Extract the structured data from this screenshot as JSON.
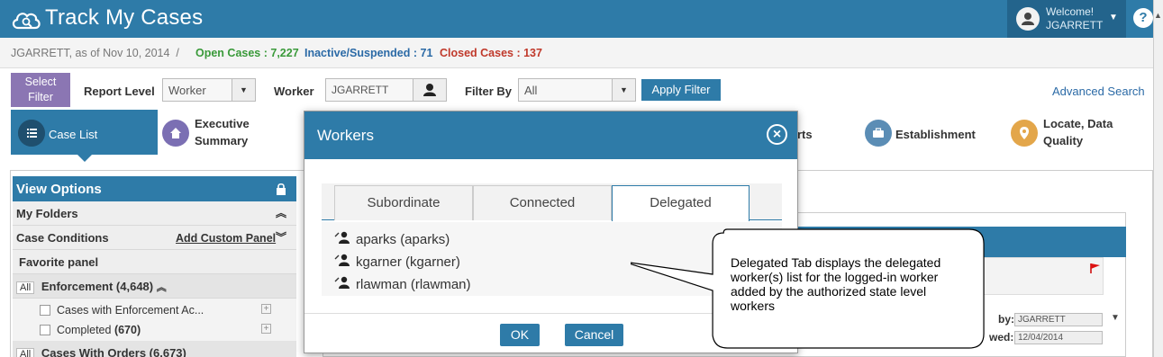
{
  "header": {
    "title": "Track My Cases",
    "welcome_label": "Welcome!",
    "welcome_user": "JGARRETT",
    "help_label": "?"
  },
  "status": {
    "user_date": "JGARRETT, as of Nov 10, 2014",
    "separator": "/",
    "open_cases": "Open Cases : 7,227",
    "inactive": "Inactive/Suspended : 71",
    "closed_cases": "Closed Cases : 137"
  },
  "filter": {
    "select_filter_line1": "Select",
    "select_filter_line2": "Filter",
    "report_level_label": "Report Level",
    "report_level_value": "Worker",
    "worker_label": "Worker",
    "worker_value": "JGARRETT",
    "filter_by_label": "Filter By",
    "filter_by_value": "All",
    "apply_label": "Apply Filter",
    "advanced_search": "Advanced Search"
  },
  "tabs": [
    {
      "label": "Case List",
      "icon": "list-icon"
    },
    {
      "label_line1": "Executive",
      "label_line2": "Summary",
      "icon": "home-icon"
    },
    {
      "label": "rts"
    },
    {
      "label": "Establishment",
      "icon": "briefcase-icon"
    },
    {
      "label_line1": "Locate, Data",
      "label_line2": "Quality",
      "icon": "location-pin-icon"
    }
  ],
  "sidebar": {
    "title": "View Options",
    "my_folders": "My Folders",
    "case_conditions": "Case Conditions",
    "add_custom_panel": "Add Custom Panel",
    "favorite_panel": "Favorite panel",
    "all_chip": "All",
    "enforcement": "Enforcement (4,648)",
    "item1_label": "Cases with Enforcement Ac...",
    "item2_label": "Completed",
    "item2_count": "(670)",
    "cases_with_orders": "Cases With Orders (6,673)"
  },
  "background_panel": {
    "by_label": "by:",
    "by_value": "JGARRETT",
    "wed_label": "wed:",
    "wed_value": "12/04/2014"
  },
  "modal": {
    "title": "Workers",
    "tabs": [
      "Subordinate",
      "Connected",
      "Delegated"
    ],
    "active_tab": "Delegated",
    "workers": [
      "aparks (aparks)",
      "kgarner (kgarner)",
      "rlawman (rlawman)"
    ],
    "ok_label": "OK",
    "cancel_label": "Cancel"
  },
  "callout": {
    "text_line1": "Delegated Tab displays the delegated",
    "text_line2": "worker(s) list for the logged-in worker",
    "text_line3": "added by the authorized state level",
    "text_line4": "workers"
  },
  "colors": {
    "brand_blue": "#2e7ba8",
    "open_green": "#3a9a3a",
    "inactive_blue": "#2b6aa6",
    "closed_red": "#c0392b",
    "select_filter_purple": "#8b76b3"
  }
}
